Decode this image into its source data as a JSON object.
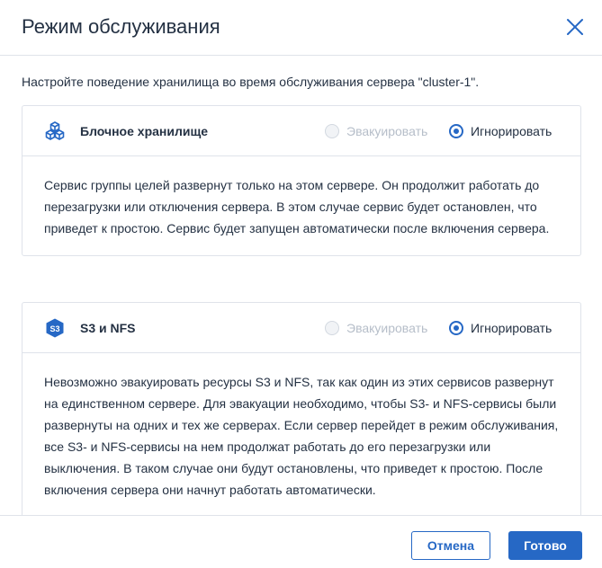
{
  "dialog": {
    "title": "Режим обслуживания",
    "close_icon": "close-icon"
  },
  "intro": "Настройте поведение хранилища во время обслуживания сервера \"cluster-1\".",
  "sections": [
    {
      "icon": "cubes-icon",
      "title": "Блочное хранилище",
      "options": [
        {
          "label": "Эвакуировать",
          "state": "disabled"
        },
        {
          "label": "Игнорировать",
          "state": "selected"
        }
      ],
      "description": "Сервис группы целей развернут только на этом сервере. Он продолжит работать до перезагрузки или отключения сервера. В этом случае сервис будет остановлен, что приведет к простою. Сервис будет запущен автоматически после включения сервера."
    },
    {
      "icon": "s3-icon",
      "icon_text": "S3",
      "title": "S3 и NFS",
      "options": [
        {
          "label": "Эвакуировать",
          "state": "disabled"
        },
        {
          "label": "Игнорировать",
          "state": "selected"
        }
      ],
      "description": "Невозможно эвакуировать ресурсы S3 и NFS, так как один из этих сервисов развернут на единственном сервере. Для эвакуации необходимо, чтобы S3- и NFS-сервисы были развернуты на одних и тех же серверах. Если сервер перейдет в режим обслуживания, все S3- и NFS-сервисы на нем продолжат работать до его перезагрузки или выключения. В таком случае они будут остановлены, что приведет к простою. После включения сервера они начнут работать автоматически."
    }
  ],
  "footer": {
    "cancel_label": "Отмена",
    "ok_label": "Готово"
  },
  "colors": {
    "accent": "#2668c5",
    "text": "#243143",
    "disabled": "#b6bec9",
    "border": "#dfe3ea"
  }
}
